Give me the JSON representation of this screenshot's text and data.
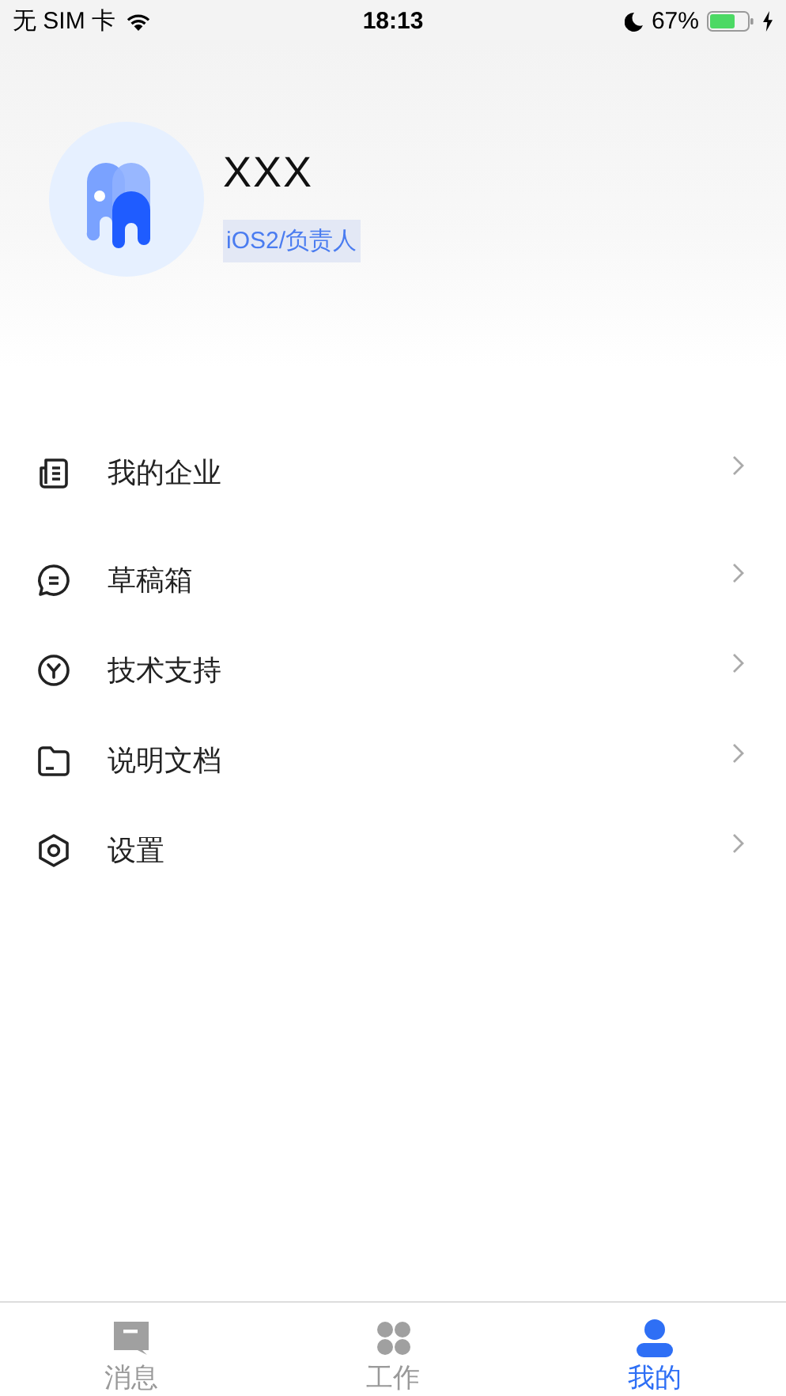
{
  "status_bar": {
    "carrier": "无 SIM 卡",
    "time": "18:13",
    "battery_percent": "67%"
  },
  "profile": {
    "name": "XXX",
    "role": "iOS2/负责人"
  },
  "menu": [
    {
      "kind": "company",
      "label": "我的企业"
    },
    {
      "kind": "drafts",
      "label": "草稿箱"
    },
    {
      "kind": "support",
      "label": "技术支持"
    },
    {
      "kind": "docs",
      "label": "说明文档"
    },
    {
      "kind": "settings",
      "label": "设置"
    }
  ],
  "tab_bar": [
    {
      "kind": "messages",
      "label": "消息",
      "selected": false
    },
    {
      "kind": "work",
      "label": "工作",
      "selected": false
    },
    {
      "kind": "me",
      "label": "我的",
      "selected": true
    }
  ]
}
